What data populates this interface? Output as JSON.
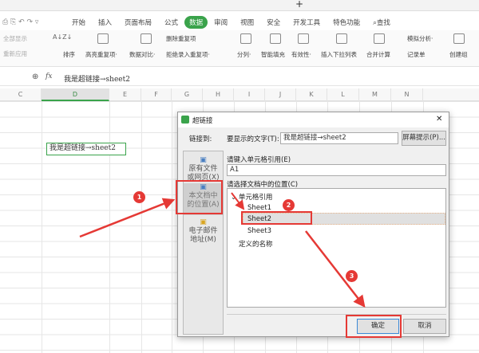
{
  "ribbon": {
    "tabs": [
      "开始",
      "插入",
      "页面布局",
      "公式",
      "数据",
      "审阅",
      "视图",
      "安全",
      "开发工具",
      "特色功能",
      "查找"
    ],
    "active_tab": "数据",
    "items": [
      "全部显示",
      "重新应用",
      "排序",
      "高亮重复项·",
      "数据对比·",
      "删除重复项",
      "拒绝录入重复项·",
      "分列·",
      "智能填充",
      "有效性·",
      "插入下拉列表",
      "合并计算",
      "模拟分析·",
      "记录单",
      "创建组"
    ]
  },
  "formula_bar": {
    "fx": "fx",
    "value": "我是超链接→sheet2"
  },
  "columns": [
    "C",
    "D",
    "E",
    "F",
    "G",
    "H",
    "I",
    "J",
    "K",
    "L",
    "M",
    "N"
  ],
  "selected_column": "D",
  "cell_text": "我是超链接→sheet2",
  "dialog": {
    "title": "超链接",
    "link_to": "链接到:",
    "display_text_label": "要显示的文字(T):",
    "display_text_value": "我是超链接→sheet2",
    "screen_tip": "屏幕提示(P)...",
    "cell_ref_label": "请键入单元格引用(E)",
    "cell_ref_value": "A1",
    "location_label": "请选择文档中的位置(C)",
    "sidebar": [
      {
        "l1": "原有文件",
        "l2": "或网页(X)"
      },
      {
        "l1": "本文档中",
        "l2": "的位置(A)"
      },
      {
        "l1": "电子邮件",
        "l2": "地址(M)"
      }
    ],
    "tree": {
      "root": "单元格引用",
      "sheets": [
        "Sheet1",
        "Sheet2",
        "Sheet3"
      ],
      "names": "定义的名称",
      "selected": "Sheet2"
    },
    "ok": "确定",
    "cancel": "取消",
    "close": "✕"
  },
  "annotations": [
    "1",
    "2",
    "3"
  ],
  "colors": {
    "accent": "#3aa34b",
    "annotation": "#e53935"
  }
}
